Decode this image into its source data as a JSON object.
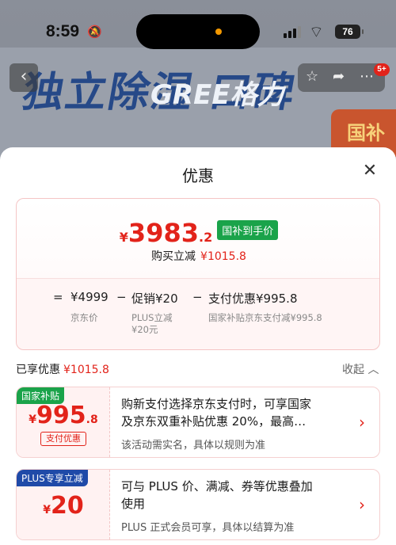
{
  "status_bar": {
    "time": "8:59",
    "battery": "76"
  },
  "background": {
    "hero_text": "独立除湿 口碑",
    "brand": "GREE格力",
    "badge": "国补贴",
    "notification_count": "5+"
  },
  "sheet": {
    "title": "优惠",
    "final_price": {
      "currency": "¥",
      "integer": "3983",
      "decimal": ".2"
    },
    "final_price_tag": "国补到手价",
    "immediate_cut_label": "购买立减",
    "immediate_cut_value": "¥1015.8",
    "breakdown": {
      "equals": "=",
      "jd_price": "¥4999",
      "jd_price_label": "京东价",
      "minus1": "−",
      "promo": "促销¥20",
      "promo_label_line1": "PLUS立减",
      "promo_label_line2": "¥20元",
      "minus2": "−",
      "pay": "支付优惠¥995.8",
      "pay_label": "国家补贴京东支付减¥995.8"
    },
    "enjoyed_label": "已享优惠",
    "enjoyed_value": "¥1015.8",
    "collapse_label": "收起",
    "cards": [
      {
        "tag": "国家补贴",
        "amount": {
          "currency": "¥",
          "integer": "995",
          "decimal": ".8"
        },
        "sub_tag": "支付优惠",
        "main_line1": "购新支付选择京东支付时，可享国家",
        "main_line2": "及京东双重补贴优惠 20%，最高…",
        "note": "该活动需实名，具体以规则为准"
      },
      {
        "tag": "PLUS专享立减",
        "amount": {
          "currency": "¥",
          "integer": "20",
          "decimal": ""
        },
        "main_line1": "可与 PLUS 价、满减、券等优惠叠加",
        "main_line2": "使用",
        "note": "PLUS 正式会员可享，具体以结算为准"
      }
    ]
  }
}
